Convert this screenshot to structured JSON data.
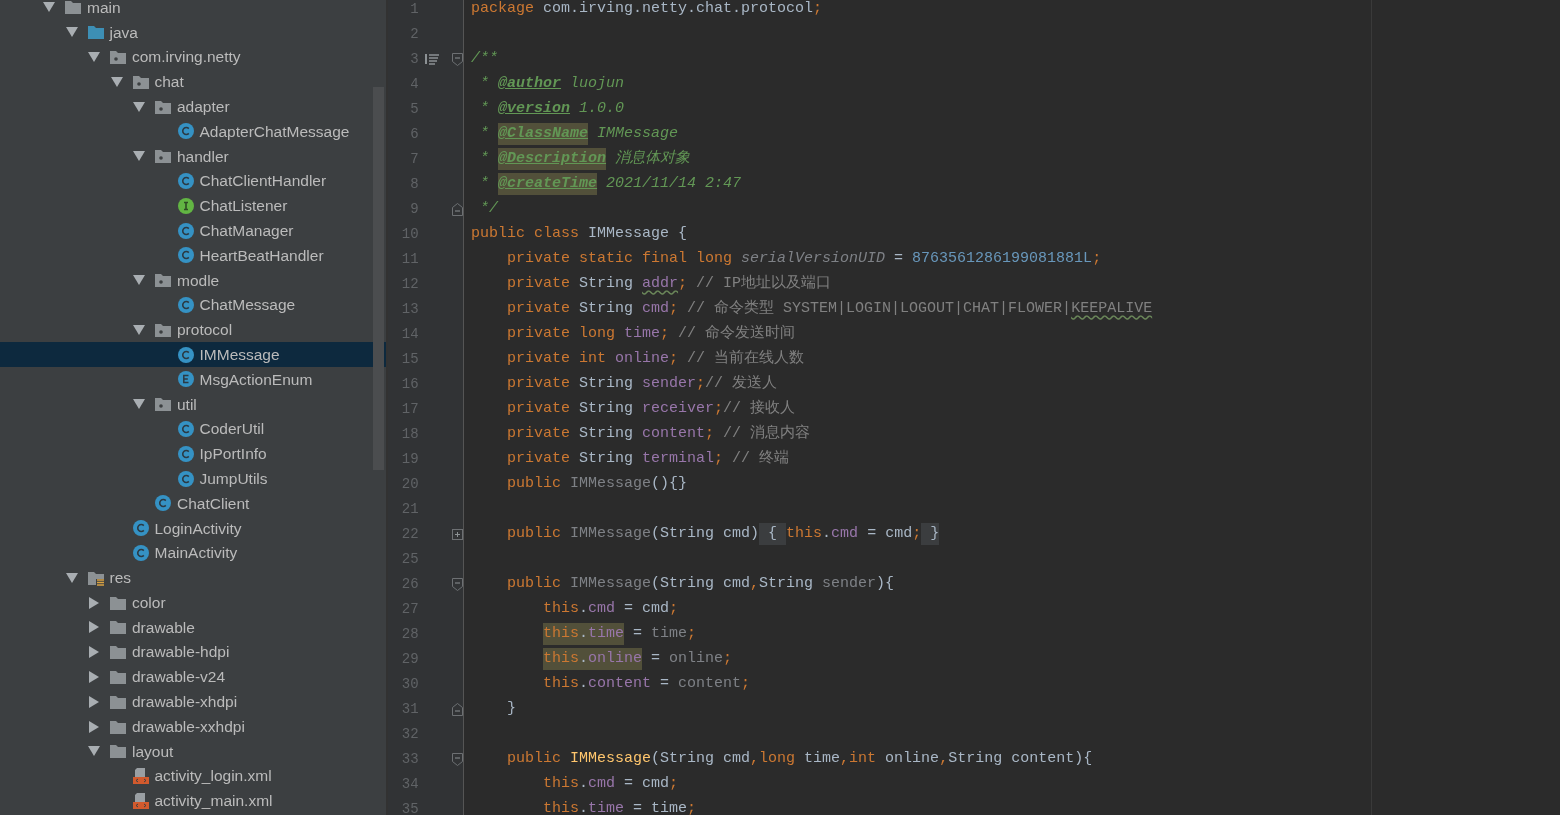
{
  "project_tree": [
    {
      "name": "main",
      "kind": "folder",
      "expanded": true,
      "selected": false,
      "children": [
        {
          "name": "java",
          "kind": "source-folder",
          "expanded": true,
          "selected": false,
          "children": [
            {
              "name": "com.irving.netty",
              "kind": "package",
              "expanded": true,
              "selected": false,
              "children": [
                {
                  "name": "chat",
                  "kind": "package",
                  "expanded": true,
                  "selected": false,
                  "children": [
                    {
                      "name": "adapter",
                      "kind": "package",
                      "expanded": true,
                      "selected": false,
                      "children": [
                        {
                          "name": "AdapterChatMessage",
                          "kind": "class",
                          "selected": false
                        }
                      ]
                    },
                    {
                      "name": "handler",
                      "kind": "package",
                      "expanded": true,
                      "selected": false,
                      "children": [
                        {
                          "name": "ChatClientHandler",
                          "kind": "class",
                          "selected": false
                        },
                        {
                          "name": "ChatListener",
                          "kind": "interface",
                          "selected": false
                        },
                        {
                          "name": "ChatManager",
                          "kind": "class",
                          "selected": false
                        },
                        {
                          "name": "HeartBeatHandler",
                          "kind": "class",
                          "selected": false
                        }
                      ]
                    },
                    {
                      "name": "modle",
                      "kind": "package",
                      "expanded": true,
                      "selected": false,
                      "children": [
                        {
                          "name": "ChatMessage",
                          "kind": "class",
                          "selected": false
                        }
                      ]
                    },
                    {
                      "name": "protocol",
                      "kind": "package",
                      "expanded": true,
                      "selected": false,
                      "children": [
                        {
                          "name": "IMMessage",
                          "kind": "class",
                          "selected": true
                        },
                        {
                          "name": "MsgActionEnum",
                          "kind": "enum",
                          "selected": false
                        }
                      ]
                    },
                    {
                      "name": "util",
                      "kind": "package",
                      "expanded": true,
                      "selected": false,
                      "children": [
                        {
                          "name": "CoderUtil",
                          "kind": "class",
                          "selected": false
                        },
                        {
                          "name": "IpPortInfo",
                          "kind": "class",
                          "selected": false
                        },
                        {
                          "name": "JumpUtils",
                          "kind": "class",
                          "selected": false
                        }
                      ]
                    },
                    {
                      "name": "ChatClient",
                      "kind": "class",
                      "selected": false
                    }
                  ]
                },
                {
                  "name": "LoginActivity",
                  "kind": "class",
                  "selected": false
                },
                {
                  "name": "MainActivity",
                  "kind": "class",
                  "selected": false
                }
              ]
            }
          ]
        },
        {
          "name": "res",
          "kind": "res-folder",
          "expanded": true,
          "selected": false,
          "children": [
            {
              "name": "color",
              "kind": "folder",
              "expanded": false,
              "selected": false
            },
            {
              "name": "drawable",
              "kind": "folder",
              "expanded": false,
              "selected": false
            },
            {
              "name": "drawable-hdpi",
              "kind": "folder",
              "expanded": false,
              "selected": false
            },
            {
              "name": "drawable-v24",
              "kind": "folder",
              "expanded": false,
              "selected": false
            },
            {
              "name": "drawable-xhdpi",
              "kind": "folder",
              "expanded": false,
              "selected": false
            },
            {
              "name": "drawable-xxhdpi",
              "kind": "folder",
              "expanded": false,
              "selected": false
            },
            {
              "name": "layout",
              "kind": "folder",
              "expanded": true,
              "selected": false,
              "children": [
                {
                  "name": "activity_login.xml",
                  "kind": "layout-file",
                  "selected": false
                },
                {
                  "name": "activity_main.xml",
                  "kind": "layout-file",
                  "selected": false
                }
              ]
            }
          ]
        }
      ]
    }
  ],
  "editor": {
    "lines": [
      {
        "number": "1",
        "tokens": [
          {
            "text": "package",
            "kind": "keyword"
          },
          {
            "text": " com.irving.netty.chat.protocol",
            "kind": "plain"
          },
          {
            "text": ";",
            "kind": "keyword"
          }
        ]
      },
      {
        "number": "2"
      },
      {
        "number": "3",
        "fold_start": true,
        "doc_toggle": true,
        "tokens": [
          {
            "text": "/**",
            "kind": "doc"
          }
        ]
      },
      {
        "number": "4",
        "tokens": [
          {
            "text": " * ",
            "kind": "doc"
          },
          {
            "text": "@author",
            "kind": "doctag"
          },
          {
            "text": " luojun",
            "kind": "doc"
          }
        ]
      },
      {
        "number": "5",
        "tokens": [
          {
            "text": " * ",
            "kind": "doc"
          },
          {
            "text": "@version",
            "kind": "doctag"
          },
          {
            "text": " 1.0.0",
            "kind": "doc"
          }
        ]
      },
      {
        "number": "6",
        "tokens": [
          {
            "text": " * ",
            "kind": "doc"
          },
          {
            "text": "@ClassName",
            "kind": "doctag",
            "highlighted": true
          },
          {
            "text": " IMMessage",
            "kind": "doc"
          }
        ]
      },
      {
        "number": "7",
        "tokens": [
          {
            "text": " * ",
            "kind": "doc"
          },
          {
            "text": "@Description",
            "kind": "doctag",
            "highlighted": true
          },
          {
            "text": " 消息体对象",
            "kind": "doc"
          }
        ]
      },
      {
        "number": "8",
        "tokens": [
          {
            "text": " * ",
            "kind": "doc"
          },
          {
            "text": "@createTime",
            "kind": "doctag",
            "highlighted": true
          },
          {
            "text": " 2021/11/14 2:47",
            "kind": "doc"
          }
        ]
      },
      {
        "number": "9",
        "fold_end": true,
        "tokens": [
          {
            "text": " */",
            "kind": "doc"
          }
        ]
      },
      {
        "number": "10",
        "tokens": [
          {
            "text": "public class",
            "kind": "keyword"
          },
          {
            "text": " IMMessage {",
            "kind": "plain"
          }
        ]
      },
      {
        "number": "11",
        "class_member": true,
        "tokens": [
          {
            "text": "private static final long ",
            "kind": "keyword"
          },
          {
            "text": "serialVersionUID",
            "kind": "unused-static"
          },
          {
            "text": " = ",
            "kind": "plain"
          },
          {
            "text": "8763561286199081881L",
            "kind": "number"
          },
          {
            "text": ";",
            "kind": "keyword"
          }
        ]
      },
      {
        "number": "12",
        "class_member": true,
        "tokens": [
          {
            "text": "private",
            "kind": "keyword"
          },
          {
            "text": " String ",
            "kind": "plain"
          },
          {
            "text": "addr",
            "kind": "field",
            "squiggle": true
          },
          {
            "text": ";",
            "kind": "keyword"
          },
          {
            "text": " // IP地址以及端口",
            "kind": "comment"
          }
        ]
      },
      {
        "number": "13",
        "class_member": true,
        "tokens": [
          {
            "text": "private",
            "kind": "keyword"
          },
          {
            "text": " String ",
            "kind": "plain"
          },
          {
            "text": "cmd",
            "kind": "field"
          },
          {
            "text": ";",
            "kind": "keyword"
          },
          {
            "text": " // 命令类型 SYSTEM|LOGIN|LOGOUT|CHAT|FLOWER|",
            "kind": "comment"
          },
          {
            "text": "KEEPALIVE",
            "kind": "comment",
            "squiggle": true
          }
        ]
      },
      {
        "number": "14",
        "class_member": true,
        "tokens": [
          {
            "text": "private long ",
            "kind": "keyword"
          },
          {
            "text": "time",
            "kind": "field"
          },
          {
            "text": ";",
            "kind": "keyword"
          },
          {
            "text": " // 命令发送时间",
            "kind": "comment"
          }
        ]
      },
      {
        "number": "15",
        "class_member": true,
        "tokens": [
          {
            "text": "private int ",
            "kind": "keyword"
          },
          {
            "text": "online",
            "kind": "field"
          },
          {
            "text": ";",
            "kind": "keyword"
          },
          {
            "text": " // 当前在线人数",
            "kind": "comment"
          }
        ]
      },
      {
        "number": "16",
        "class_member": true,
        "tokens": [
          {
            "text": "private",
            "kind": "keyword"
          },
          {
            "text": " String ",
            "kind": "plain"
          },
          {
            "text": "sender",
            "kind": "field"
          },
          {
            "text": ";",
            "kind": "keyword"
          },
          {
            "text": "// 发送人",
            "kind": "comment"
          }
        ]
      },
      {
        "number": "17",
        "class_member": true,
        "tokens": [
          {
            "text": "private",
            "kind": "keyword"
          },
          {
            "text": " String ",
            "kind": "plain"
          },
          {
            "text": "receiver",
            "kind": "field"
          },
          {
            "text": ";",
            "kind": "keyword"
          },
          {
            "text": "// 接收人",
            "kind": "comment"
          }
        ]
      },
      {
        "number": "18",
        "class_member": true,
        "tokens": [
          {
            "text": "private",
            "kind": "keyword"
          },
          {
            "text": " String ",
            "kind": "plain"
          },
          {
            "text": "content",
            "kind": "field"
          },
          {
            "text": ";",
            "kind": "keyword"
          },
          {
            "text": " // 消息内容",
            "kind": "comment"
          }
        ]
      },
      {
        "number": "19",
        "class_member": true,
        "tokens": [
          {
            "text": "private",
            "kind": "keyword"
          },
          {
            "text": " String ",
            "kind": "plain"
          },
          {
            "text": "terminal",
            "kind": "field"
          },
          {
            "text": ";",
            "kind": "keyword"
          },
          {
            "text": " // 终端",
            "kind": "comment"
          }
        ]
      },
      {
        "number": "20",
        "class_member": true,
        "tokens": [
          {
            "text": "public ",
            "kind": "keyword"
          },
          {
            "text": "IMMessage",
            "kind": "unused"
          },
          {
            "text": "(){}",
            "kind": "plain"
          }
        ]
      },
      {
        "number": "21"
      },
      {
        "number": "22",
        "class_member": true,
        "folded": true,
        "tokens": [
          {
            "text": "public ",
            "kind": "keyword"
          },
          {
            "text": "IMMessage",
            "kind": "unused"
          },
          {
            "text": "(String cmd)",
            "kind": "plain"
          },
          {
            "text": " { ",
            "kind": "folded"
          },
          {
            "text": "this",
            "kind": "keyword"
          },
          {
            "text": ".",
            "kind": "plain"
          },
          {
            "text": "cmd",
            "kind": "field"
          },
          {
            "text": " = cmd",
            "kind": "plain"
          },
          {
            "text": ";",
            "kind": "keyword"
          },
          {
            "text": " }",
            "kind": "folded"
          }
        ]
      },
      {
        "number": "25"
      },
      {
        "number": "26",
        "class_member": true,
        "fold_start": true,
        "tokens": [
          {
            "text": "public ",
            "kind": "keyword"
          },
          {
            "text": "IMMessage",
            "kind": "unused"
          },
          {
            "text": "(String cmd",
            "kind": "plain"
          },
          {
            "text": ",",
            "kind": "keyword"
          },
          {
            "text": "String ",
            "kind": "plain"
          },
          {
            "text": "sender",
            "kind": "unused"
          },
          {
            "text": "){",
            "kind": "plain"
          }
        ]
      },
      {
        "number": "27",
        "method_body": true,
        "tokens": [
          {
            "text": "this",
            "kind": "keyword"
          },
          {
            "text": ".",
            "kind": "plain"
          },
          {
            "text": "cmd",
            "kind": "field"
          },
          {
            "text": " = cmd",
            "kind": "plain"
          },
          {
            "text": ";",
            "kind": "keyword"
          }
        ]
      },
      {
        "number": "28",
        "method_body": true,
        "tokens": [
          {
            "text": "this",
            "kind": "keyword",
            "highlighted": true
          },
          {
            "text": ".",
            "kind": "plain",
            "highlighted": true
          },
          {
            "text": "time",
            "kind": "field",
            "highlighted": true
          },
          {
            "text": " = ",
            "kind": "plain"
          },
          {
            "text": "time",
            "kind": "unused"
          },
          {
            "text": ";",
            "kind": "keyword"
          }
        ]
      },
      {
        "number": "29",
        "method_body": true,
        "tokens": [
          {
            "text": "this",
            "kind": "keyword",
            "highlighted": true
          },
          {
            "text": ".",
            "kind": "plain",
            "highlighted": true
          },
          {
            "text": "online",
            "kind": "field",
            "highlighted": true
          },
          {
            "text": " = ",
            "kind": "plain"
          },
          {
            "text": "online",
            "kind": "unused"
          },
          {
            "text": ";",
            "kind": "keyword"
          }
        ]
      },
      {
        "number": "30",
        "method_body": true,
        "tokens": [
          {
            "text": "this",
            "kind": "keyword"
          },
          {
            "text": ".",
            "kind": "plain"
          },
          {
            "text": "content",
            "kind": "field"
          },
          {
            "text": " = ",
            "kind": "plain"
          },
          {
            "text": "content",
            "kind": "unused"
          },
          {
            "text": ";",
            "kind": "keyword"
          }
        ]
      },
      {
        "number": "31",
        "class_member": true,
        "fold_end": true,
        "tokens": [
          {
            "text": "}",
            "kind": "plain"
          }
        ]
      },
      {
        "number": "32"
      },
      {
        "number": "33",
        "class_member": true,
        "fold_start": true,
        "tokens": [
          {
            "text": "public ",
            "kind": "keyword"
          },
          {
            "text": "IMMessage",
            "kind": "method"
          },
          {
            "text": "(String cmd",
            "kind": "plain"
          },
          {
            "text": ",long",
            "kind": "keyword"
          },
          {
            "text": " time",
            "kind": "plain"
          },
          {
            "text": ",int",
            "kind": "keyword"
          },
          {
            "text": " online",
            "kind": "plain"
          },
          {
            "text": ",",
            "kind": "keyword"
          },
          {
            "text": "String content){",
            "kind": "plain"
          }
        ]
      },
      {
        "number": "34",
        "method_body": true,
        "tokens": [
          {
            "text": "this",
            "kind": "keyword"
          },
          {
            "text": ".",
            "kind": "plain"
          },
          {
            "text": "cmd",
            "kind": "field"
          },
          {
            "text": " = cmd",
            "kind": "plain"
          },
          {
            "text": ";",
            "kind": "keyword"
          }
        ]
      },
      {
        "number": "35",
        "method_body": true,
        "tokens": [
          {
            "text": "this",
            "kind": "keyword"
          },
          {
            "text": ".",
            "kind": "plain"
          },
          {
            "text": "time",
            "kind": "field"
          },
          {
            "text": " = time",
            "kind": "plain"
          },
          {
            "text": ";",
            "kind": "keyword"
          }
        ]
      }
    ]
  }
}
